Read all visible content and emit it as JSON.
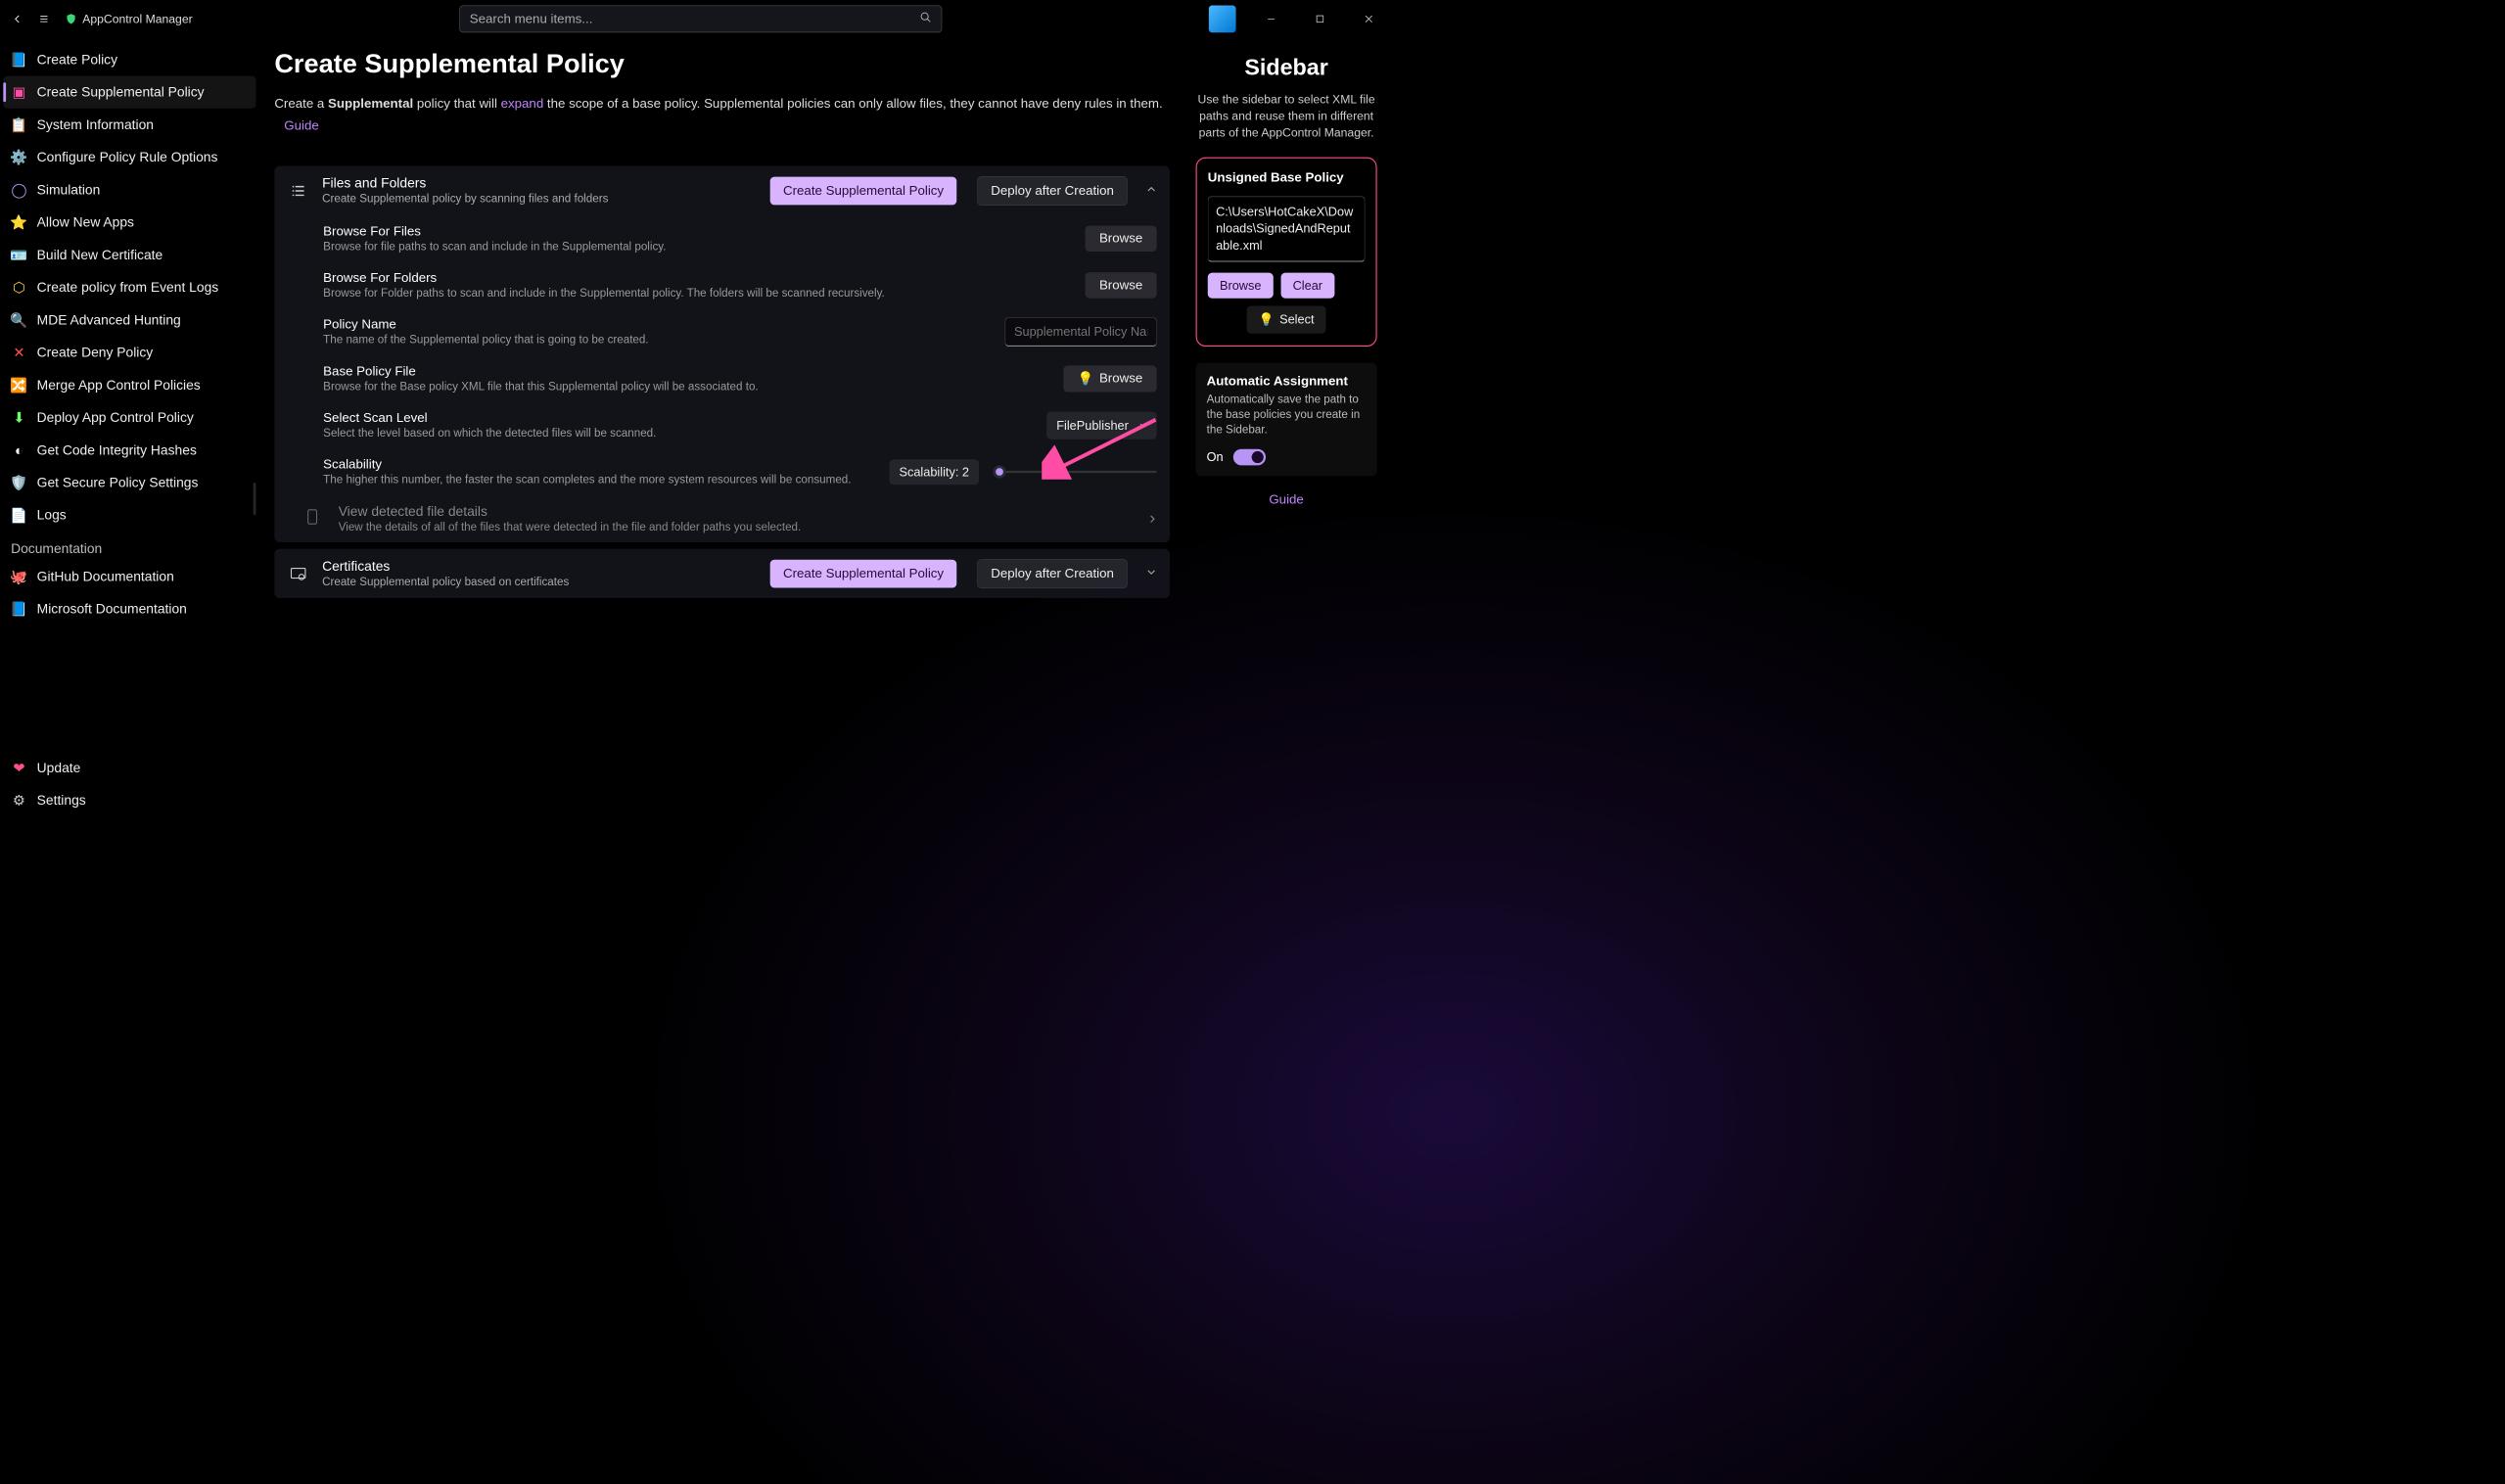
{
  "app": {
    "title": "AppControl Manager"
  },
  "search": {
    "placeholder": "Search menu items..."
  },
  "nav": {
    "items": [
      {
        "label": "Create Policy"
      },
      {
        "label": "Create Supplemental Policy"
      },
      {
        "label": "System Information"
      },
      {
        "label": "Configure Policy Rule Options"
      },
      {
        "label": "Simulation"
      },
      {
        "label": "Allow New Apps"
      },
      {
        "label": "Build New Certificate"
      },
      {
        "label": "Create policy from Event Logs"
      },
      {
        "label": "MDE Advanced Hunting"
      },
      {
        "label": "Create Deny Policy"
      },
      {
        "label": "Merge App Control Policies"
      },
      {
        "label": "Deploy App Control Policy"
      },
      {
        "label": "Get Code Integrity Hashes"
      },
      {
        "label": "Get Secure Policy Settings"
      },
      {
        "label": "Logs"
      }
    ],
    "docSection": "Documentation",
    "docItems": [
      {
        "label": "GitHub Documentation"
      },
      {
        "label": "Microsoft Documentation"
      }
    ],
    "bottomItems": [
      {
        "label": "Update"
      },
      {
        "label": "Settings"
      }
    ]
  },
  "page": {
    "title": "Create Supplemental Policy",
    "desc_prefix": "Create a ",
    "desc_bold": "Supplemental",
    "desc_mid": " policy that will ",
    "desc_link": "expand",
    "desc_suffix": " the scope of a base policy. Supplemental policies can only allow files, they cannot have deny rules in them.",
    "guide": "Guide"
  },
  "files_card": {
    "title": "Files and Folders",
    "sub": "Create Supplemental policy by scanning files and folders",
    "create_btn": "Create Supplemental Policy",
    "deploy_btn": "Deploy after Creation",
    "rows": {
      "browse_files": {
        "title": "Browse For Files",
        "sub": "Browse for file paths to scan and include in the Supplemental policy.",
        "btn": "Browse"
      },
      "browse_folders": {
        "title": "Browse For Folders",
        "sub": "Browse for Folder paths to scan and include in the Supplemental policy. The folders will be scanned recursively.",
        "btn": "Browse"
      },
      "policy_name": {
        "title": "Policy Name",
        "sub": "The name of the Supplemental policy that is going to be created.",
        "placeholder": "Supplemental Policy Name"
      },
      "base_policy": {
        "title": "Base Policy File",
        "sub": "Browse for the Base policy XML file that this Supplemental policy will be associated to.",
        "btn": "Browse"
      },
      "scan_level": {
        "title": "Select Scan Level",
        "sub": "Select the level based on which the detected files will be scanned.",
        "value": "FilePublisher"
      },
      "scalability": {
        "title": "Scalability",
        "sub": "The higher this number, the faster the scan completes and the more system resources will be consumed.",
        "label": "Scalability: 2"
      },
      "details": {
        "title": "View detected file details",
        "sub": "View the details of all of the files that were detected in the file and folder paths you selected."
      }
    }
  },
  "certs_card": {
    "title": "Certificates",
    "sub": "Create Supplemental policy based on certificates",
    "create_btn": "Create Supplemental Policy",
    "deploy_btn": "Deploy after Creation"
  },
  "right": {
    "title": "Sidebar",
    "desc": "Use the sidebar to select XML file paths and reuse them in different parts of the AppControl Manager.",
    "box_title": "Unsigned Base Policy",
    "path": "C:\\Users\\HotCakeX\\Downloads\\SignedAndReputable.xml",
    "browse": "Browse",
    "clear": "Clear",
    "select": "Select",
    "auto_title": "Automatic Assignment",
    "auto_sub": "Automatically save the path to the base policies you create in the Sidebar.",
    "toggle_label": "On",
    "guide": "Guide"
  }
}
